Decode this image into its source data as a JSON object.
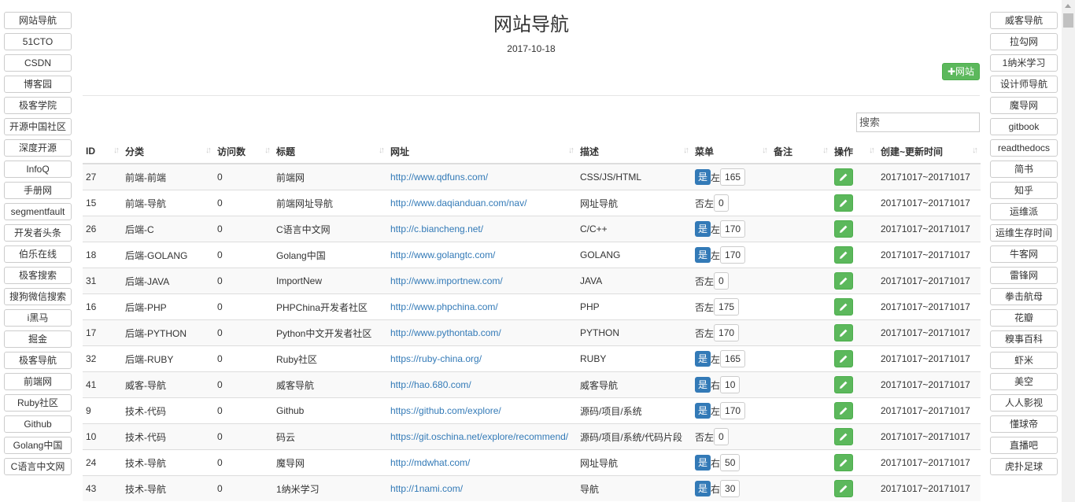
{
  "page": {
    "title": "网站导航",
    "date": "2017-10-18",
    "add_label": "网站"
  },
  "search": {
    "placeholder": "搜索"
  },
  "left_nav": [
    "网站导航",
    "51CTO",
    "CSDN",
    "博客园",
    "极客学院",
    "开源中国社区",
    "深度开源",
    "InfoQ",
    "手册网",
    "segmentfault",
    "开发者头条",
    "伯乐在线",
    "极客搜索",
    "搜狗微信搜索",
    "i黑马",
    "掘金",
    "极客导航",
    "前端网",
    "Ruby社区",
    "Github",
    "Golang中国",
    "C语言中文网"
  ],
  "right_nav": [
    "威客导航",
    "拉勾网",
    "1纳米学习",
    "设计师导航",
    "魔导网",
    "gitbook",
    "readthedocs",
    "简书",
    "知乎",
    "运维派",
    "运维生存时间",
    "牛客网",
    "雷锋网",
    "拳击航母",
    "花瓣",
    "糗事百科",
    "虾米",
    "美空",
    "人人影视",
    "懂球帝",
    "直播吧",
    "虎扑足球"
  ],
  "table": {
    "headers": [
      "ID",
      "分类",
      "访问数",
      "标题",
      "网址",
      "描述",
      "菜单",
      "备注",
      "操作",
      "创建~更新时间"
    ],
    "rows": [
      {
        "id": "27",
        "cat": "前端-前端",
        "visits": "0",
        "title": "前端网",
        "url": "http://www.qdfuns.com/",
        "desc": "CSS/JS/HTML",
        "menu": "是",
        "pos": "左",
        "sort": "165",
        "time": "20171017~20171017"
      },
      {
        "id": "15",
        "cat": "前端-导航",
        "visits": "0",
        "title": "前端网址导航",
        "url": "http://www.daqianduan.com/nav/",
        "desc": "网址导航",
        "menu": "否",
        "pos": "左",
        "sort": "0",
        "time": "20171017~20171017"
      },
      {
        "id": "26",
        "cat": "后端-C",
        "visits": "0",
        "title": "C语言中文网",
        "url": "http://c.biancheng.net/",
        "desc": "C/C++",
        "menu": "是",
        "pos": "左",
        "sort": "170",
        "time": "20171017~20171017"
      },
      {
        "id": "18",
        "cat": "后端-GOLANG",
        "visits": "0",
        "title": "Golang中国",
        "url": "http://www.golangtc.com/",
        "desc": "GOLANG",
        "menu": "是",
        "pos": "左",
        "sort": "170",
        "time": "20171017~20171017"
      },
      {
        "id": "31",
        "cat": "后端-JAVA",
        "visits": "0",
        "title": "ImportNew",
        "url": "http://www.importnew.com/",
        "desc": "JAVA",
        "menu": "否",
        "pos": "左",
        "sort": "0",
        "time": "20171017~20171017"
      },
      {
        "id": "16",
        "cat": "后端-PHP",
        "visits": "0",
        "title": "PHPChina开发者社区",
        "url": "http://www.phpchina.com/",
        "desc": "PHP",
        "menu": "否",
        "pos": "左",
        "sort": "175",
        "time": "20171017~20171017"
      },
      {
        "id": "17",
        "cat": "后端-PYTHON",
        "visits": "0",
        "title": "Python中文开发者社区",
        "url": "http://www.pythontab.com/",
        "desc": "PYTHON",
        "menu": "否",
        "pos": "左",
        "sort": "170",
        "time": "20171017~20171017"
      },
      {
        "id": "32",
        "cat": "后端-RUBY",
        "visits": "0",
        "title": "Ruby社区",
        "url": "https://ruby-china.org/",
        "desc": "RUBY",
        "menu": "是",
        "pos": "左",
        "sort": "165",
        "time": "20171017~20171017"
      },
      {
        "id": "41",
        "cat": "威客-导航",
        "visits": "0",
        "title": "威客导航",
        "url": "http://hao.680.com/",
        "desc": "威客导航",
        "menu": "是",
        "pos": "右",
        "sort": "10",
        "time": "20171017~20171017"
      },
      {
        "id": "9",
        "cat": "技术-代码",
        "visits": "0",
        "title": "Github",
        "url": "https://github.com/explore/",
        "desc": "源码/项目/系统",
        "menu": "是",
        "pos": "左",
        "sort": "170",
        "time": "20171017~20171017"
      },
      {
        "id": "10",
        "cat": "技术-代码",
        "visits": "0",
        "title": "码云",
        "url": "https://git.oschina.net/explore/recommend/",
        "desc": "源码/项目/系统/代码片段",
        "menu": "否",
        "pos": "左",
        "sort": "0",
        "time": "20171017~20171017"
      },
      {
        "id": "24",
        "cat": "技术-导航",
        "visits": "0",
        "title": "魔导网",
        "url": "http://mdwhat.com/",
        "desc": "网址导航",
        "menu": "是",
        "pos": "右",
        "sort": "50",
        "time": "20171017~20171017"
      },
      {
        "id": "43",
        "cat": "技术-导航",
        "visits": "0",
        "title": "1纳米学习",
        "url": "http://1nami.com/",
        "desc": "导航",
        "menu": "是",
        "pos": "右",
        "sort": "30",
        "time": "20171017~20171017"
      }
    ]
  }
}
